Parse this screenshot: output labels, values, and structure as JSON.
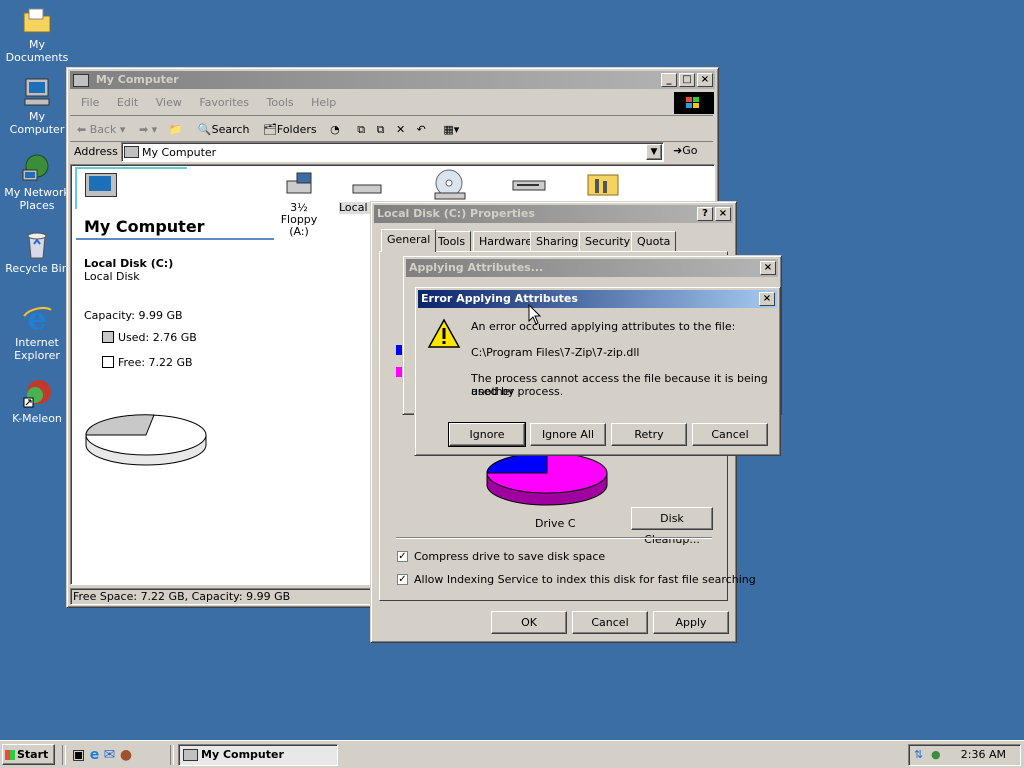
{
  "desktop": {
    "icons": [
      {
        "label": "My Documents"
      },
      {
        "label": "My Computer"
      },
      {
        "label": "My Network Places"
      },
      {
        "label": "Recycle Bin"
      },
      {
        "label": "Internet Explorer"
      },
      {
        "label": "K-Meleon"
      }
    ]
  },
  "explorer": {
    "title": "My Computer",
    "menu": [
      "File",
      "Edit",
      "View",
      "Favorites",
      "Tools",
      "Help"
    ],
    "toolbar": {
      "back": "Back",
      "search": "Search",
      "folders": "Folders"
    },
    "address_label": "Address",
    "address_value": "My Computer",
    "go_label": "Go",
    "heading": "My Computer",
    "selected_name": "Local Disk (C:)",
    "selected_type": "Local Disk",
    "capacity": "Capacity: 9.99 GB",
    "used": "Used: 2.76 GB",
    "free": "Free: 7.22 GB",
    "drives": [
      {
        "label": "3½ Floppy (A:)"
      },
      {
        "label": "Local D"
      }
    ],
    "status": "Free Space: 7.22 GB, Capacity: 9.99 GB"
  },
  "properties": {
    "title": "Local Disk (C:) Properties",
    "tabs": [
      "General",
      "Tools",
      "Hardware",
      "Sharing",
      "Security",
      "Quota"
    ],
    "drive_label": "Drive C",
    "disk_cleanup": "Disk Cleanup...",
    "compress": "Compress drive to save disk space",
    "indexing": "Allow Indexing Service to index this disk for fast file searching",
    "ok": "OK",
    "cancel": "Cancel",
    "apply": "Apply"
  },
  "applying": {
    "title": "Applying Attributes..."
  },
  "error": {
    "title": "Error Applying Attributes",
    "line1": "An error occurred applying attributes to the file:",
    "path": "C:\\Program Files\\7-Zip\\7-zip.dll",
    "line2": "The process cannot access the file because it is being used by",
    "line3": "another process.",
    "ignore": "Ignore",
    "ignore_all": "Ignore All",
    "retry": "Retry",
    "cancel": "Cancel"
  },
  "taskbar": {
    "start": "Start",
    "task": "My Computer",
    "clock": "2:36 AM"
  },
  "colors": {
    "desktop": "#3a6ea5",
    "used_space": "#0000ff",
    "free_space": "#ff00ff",
    "active_title": "#0a246a"
  }
}
